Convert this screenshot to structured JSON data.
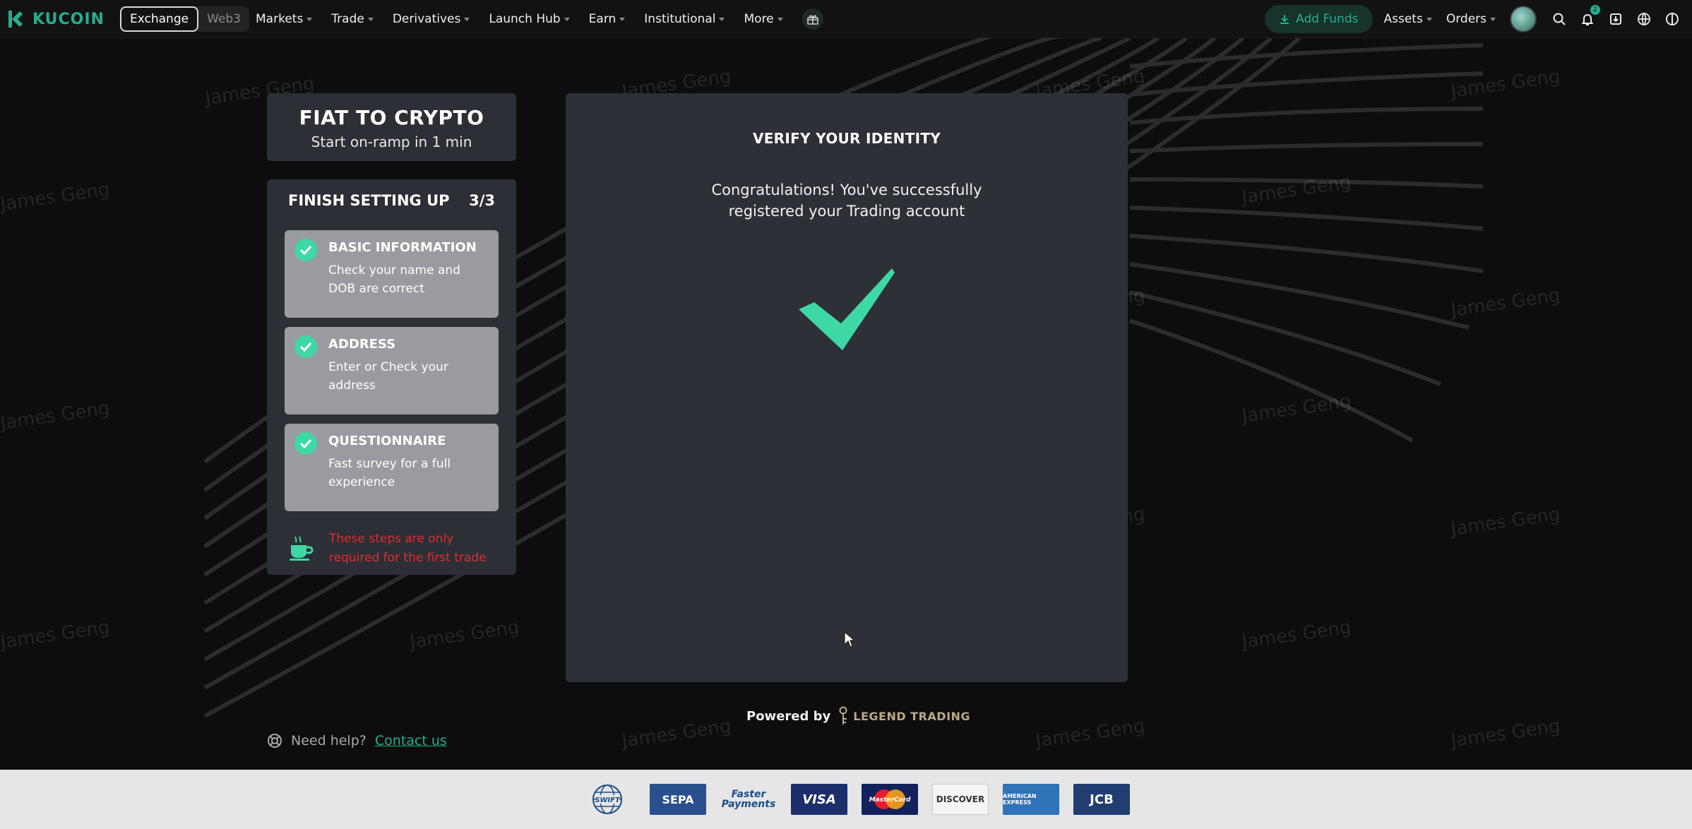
{
  "brand": {
    "name": "KUCOIN",
    "accent": "#24ae8f"
  },
  "switcher": {
    "exchange": "Exchange",
    "web3": "Web3"
  },
  "nav": {
    "items": [
      "Markets",
      "Trade",
      "Derivatives",
      "Launch Hub",
      "Earn",
      "Institutional",
      "More"
    ]
  },
  "nav_right": {
    "add_funds": "Add Funds",
    "assets": "Assets",
    "orders": "Orders",
    "notifications_count": "2"
  },
  "watermark_text": "James Geng",
  "fiat": {
    "title": "FIAT TO CRYPTO",
    "subtitle": "Start on-ramp in 1 min"
  },
  "setup": {
    "title": "FINISH SETTING UP",
    "progress": "3/3",
    "steps": [
      {
        "title": "BASIC INFORMATION",
        "desc": "Check your name and DOB are correct",
        "done": true
      },
      {
        "title": "ADDRESS",
        "desc": "Enter or Check your address",
        "done": true
      },
      {
        "title": "QUESTIONNAIRE",
        "desc": "Fast survey for a full experience",
        "done": true
      }
    ],
    "note": "These steps are only required for the first trade"
  },
  "help": {
    "text": "Need help?",
    "link": "Contact us"
  },
  "verify": {
    "title": "VERIFY YOUR IDENTITY",
    "message_line1": "Congratulations! You've successfully",
    "message_line2": "registered your Trading account",
    "check_color": "#3ed8a6"
  },
  "powered": {
    "label": "Powered by",
    "partner": "LEGEND TRADING"
  },
  "payments": [
    "SWIFT",
    "SEPA",
    "Faster Payments",
    "VISA",
    "MasterCard",
    "DISCOVER",
    "AMERICAN EXPRESS",
    "JCB"
  ]
}
